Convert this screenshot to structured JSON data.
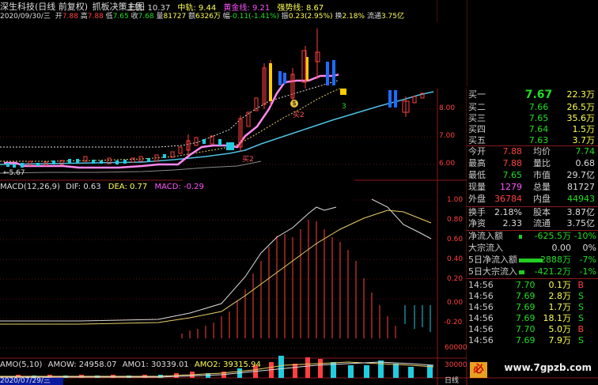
{
  "header": {
    "title": "深生科技(日线 前复权)",
    "indicator": "抓板决策主图",
    "date": "2020/09/30/三",
    "open_label": "开",
    "open": "7.88",
    "high_label": "高",
    "high": "7.88",
    "low_label": "低",
    "low": "7.65",
    "close_label": "收",
    "close": "7.68",
    "vol_label": "量",
    "vol": "81727",
    "amt_label": "额",
    "amt": "6326万",
    "chg_label": "幅",
    "chg": "-0.11(-1.41%)",
    "amp_label": "振",
    "amp": "0.23(2.95%)",
    "turn_label": "换",
    "turn": "2.18%",
    "float_label": "流通",
    "float": "3.75亿"
  },
  "main_legend": {
    "upper": "上轨: 10.37",
    "mid": "中轨: 9.44",
    "gold": "黄金线: 9.21",
    "strong": "强势线: 8.67"
  },
  "main_chart": {
    "low_marker": "←5.67",
    "signal_label": "买2",
    "signal_label2": "买2",
    "signal_3": "3",
    "money_icon": "$"
  },
  "y_axis": {
    "price_ticks": [
      "8.00",
      "7.00",
      "6.00"
    ],
    "macd_ticks": [
      "1.00",
      "0.80",
      "0.60",
      "0.40",
      "0.20",
      "0.00",
      "-0.20"
    ],
    "vol_ticks": [
      "60000",
      "30000"
    ]
  },
  "macd_legend": {
    "name": "MACD(12,26,9)",
    "dif": "DIF: 0.63",
    "dea": "DEA: 0.77",
    "macd": "MACD: -0.29"
  },
  "vol_legend": {
    "name": "AMO(5,10)",
    "amow": "AMOW: 24958.07",
    "amo1": "AMO1: 30339.01",
    "amo2": "AMO2: 39315.94"
  },
  "bottom": {
    "date": "2020/07/29/三",
    "period": "日线"
  },
  "quote": {
    "asks": [
      {
        "label": "买一",
        "price": "7.67",
        "vol": "22.3万"
      },
      {
        "label": "买二",
        "price": "7.66",
        "vol": "26.5万"
      },
      {
        "label": "买三",
        "price": "7.65",
        "vol": "35.6万"
      },
      {
        "label": "买四",
        "price": "7.64",
        "vol": "1.5万"
      },
      {
        "label": "买五",
        "price": "7.63",
        "vol": "3.7万"
      }
    ],
    "stats": [
      {
        "l1": "今开",
        "v1": "7.88",
        "c1": "red",
        "l2": "均价",
        "v2": "7.74",
        "c2": "green"
      },
      {
        "l1": "最高",
        "v1": "7.88",
        "c1": "red",
        "l2": "量比",
        "v2": "0.68",
        "c2": "white"
      },
      {
        "l1": "最低",
        "v1": "7.65",
        "c1": "green",
        "l2": "市值",
        "v2": "29.7亿",
        "c2": "white"
      },
      {
        "l1": "现量",
        "v1": "1279",
        "c1": "magenta",
        "l2": "总量",
        "v2": "81727",
        "c2": "white"
      },
      {
        "l1": "外盘",
        "v1": "36784",
        "c1": "red",
        "l2": "内盘",
        "v2": "44943",
        "c2": "green"
      }
    ],
    "stats2": [
      {
        "l1": "换手",
        "v1": "2.18%",
        "l2": "股本",
        "v2": "3.87亿"
      },
      {
        "l1": "净资",
        "v1": "2.33",
        "l2": "流通",
        "v2": "3.75亿"
      }
    ],
    "flows": [
      {
        "label": "净流入额",
        "value": "-625.5万",
        "pct": "-10%",
        "bar": 0.06
      },
      {
        "label": "大宗流入",
        "value": "0.00",
        "pct": "0%",
        "bar": 0
      },
      {
        "label": "5日净流入额",
        "value": "-2888万",
        "pct": "-7%",
        "bar": 0.9
      },
      {
        "label": "5日大宗流入",
        "value": "-421.2万",
        "pct": "-1%",
        "bar": 0.2
      }
    ],
    "ticks": [
      {
        "time": "14:56",
        "price": "7.70",
        "vol": "0.1万",
        "side": "B"
      },
      {
        "time": "14:56",
        "price": "7.69",
        "vol": "2.8万",
        "side": "S"
      },
      {
        "time": "14:56",
        "price": "7.69",
        "vol": "1.7万",
        "side": "S"
      },
      {
        "time": "14:56",
        "price": "7.69",
        "vol": "18.1万",
        "side": "S"
      },
      {
        "time": "14:56",
        "price": "7.70",
        "vol": "5.0万",
        "side": "B"
      },
      {
        "time": "14:56",
        "price": "7.69",
        "vol": "7.9万",
        "side": "S"
      }
    ]
  },
  "watermark": "www.7gpzb.com",
  "watermark_icon": "必"
}
